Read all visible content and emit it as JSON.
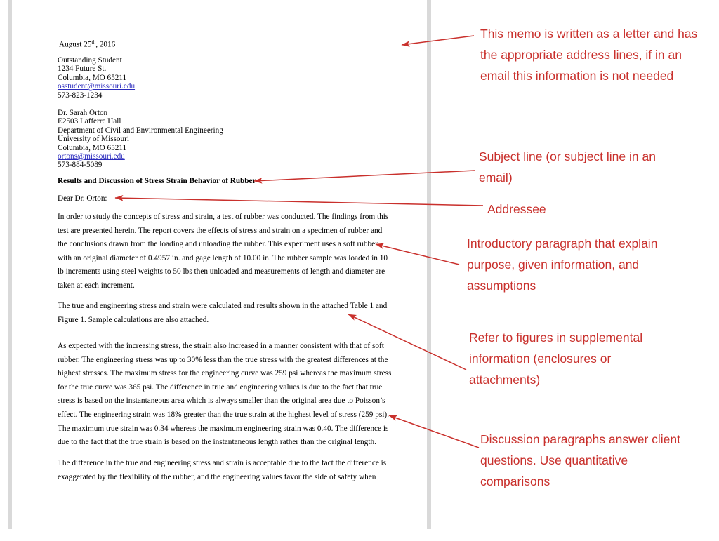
{
  "document": {
    "date": "August 25",
    "date_ordinal": "th",
    "date_year": ", 2016",
    "sender": {
      "name": "Outstanding Student",
      "street": "1234 Future St.",
      "city": "Columbia, MO 65211",
      "email": "osstudent@missouri.edu",
      "phone": "573-823-1234"
    },
    "recipient": {
      "name": "Dr. Sarah Orton",
      "office": "E2503 Lafferre Hall",
      "department": "Department of Civil and Environmental Engineering",
      "institution": "University of Missouri",
      "city": "Columbia, MO 65211",
      "email": "ortons@missouri.edu",
      "phone": "573-884-5089"
    },
    "subject": "Results and Discussion of Stress Strain Behavior of Rubber",
    "salutation": "Dear Dr. Orton:",
    "paragraphs": [
      {
        "id": "intro",
        "lines": [
          "In order to study the concepts of stress and strain, a test of rubber was conducted. The findings from this",
          "test are presented herein.  The report covers the effects of stress and strain on a specimen of rubber and",
          "the conclusions drawn from the loading and unloading the rubber.  This experiment uses a soft rubber",
          "with an original diameter of 0.4957 in. and gage length of 10.00 in.  The rubber sample was loaded in 10",
          "lb increments using steel weights to 50 lbs then unloaded and measurements of length and diameter are",
          "taken at each increment."
        ]
      },
      {
        "id": "figure-reference",
        "lines": [
          "The true and engineering stress and strain were calculated and results shown in the attached Table 1 and",
          "Figure 1.  Sample calculations are also attached."
        ]
      },
      {
        "id": "discussion",
        "lines": [
          "As expected with the increasing stress, the strain also increased in a manner consistent with that of soft",
          "rubber.  The engineering stress was up to 30% less than the true stress with the greatest differences at the",
          "highest stresses.  The maximum stress for the engineering curve was 259 psi whereas the maximum stress",
          "for the true curve was 365 psi.  The difference in true and engineering values is due to the fact that true",
          "stress is based on the instantaneous area which is always smaller than the original area due to Poisson’s",
          "effect.  The engineering strain was 18% greater than the true strain at the highest level of stress (259 psi).",
          "The maximum true strain was 0.34 whereas the maximum engineering strain was 0.40.  The difference is",
          "due to the fact that the true strain is based on the instantaneous length rather than the original length."
        ]
      },
      {
        "id": "acceptability",
        "lines": [
          "The difference in the true and engineering stress and strain is acceptable due to the fact the difference is",
          "exaggerated by the flexibility of the rubber, and the engineering values favor the side of safety when"
        ]
      }
    ]
  },
  "annotations": {
    "color": "#c9302c",
    "items": [
      {
        "id": "address-lines",
        "text": "This memo is written as a letter and has the appropriate address lines, if in an email this information is not needed"
      },
      {
        "id": "subject-line",
        "text": "Subject line (or subject line in an email)"
      },
      {
        "id": "addressee",
        "text": "Addressee"
      },
      {
        "id": "introductory-paragraph",
        "text": "Introductory paragraph that explain purpose, given information, and assumptions"
      },
      {
        "id": "refer-to-figures",
        "text": "Refer to figures in supplemental information (enclosures or attachments)"
      },
      {
        "id": "discussion-paragraphs",
        "text": "Discussion paragraphs answer client questions. Use quantitative comparisons"
      }
    ]
  }
}
